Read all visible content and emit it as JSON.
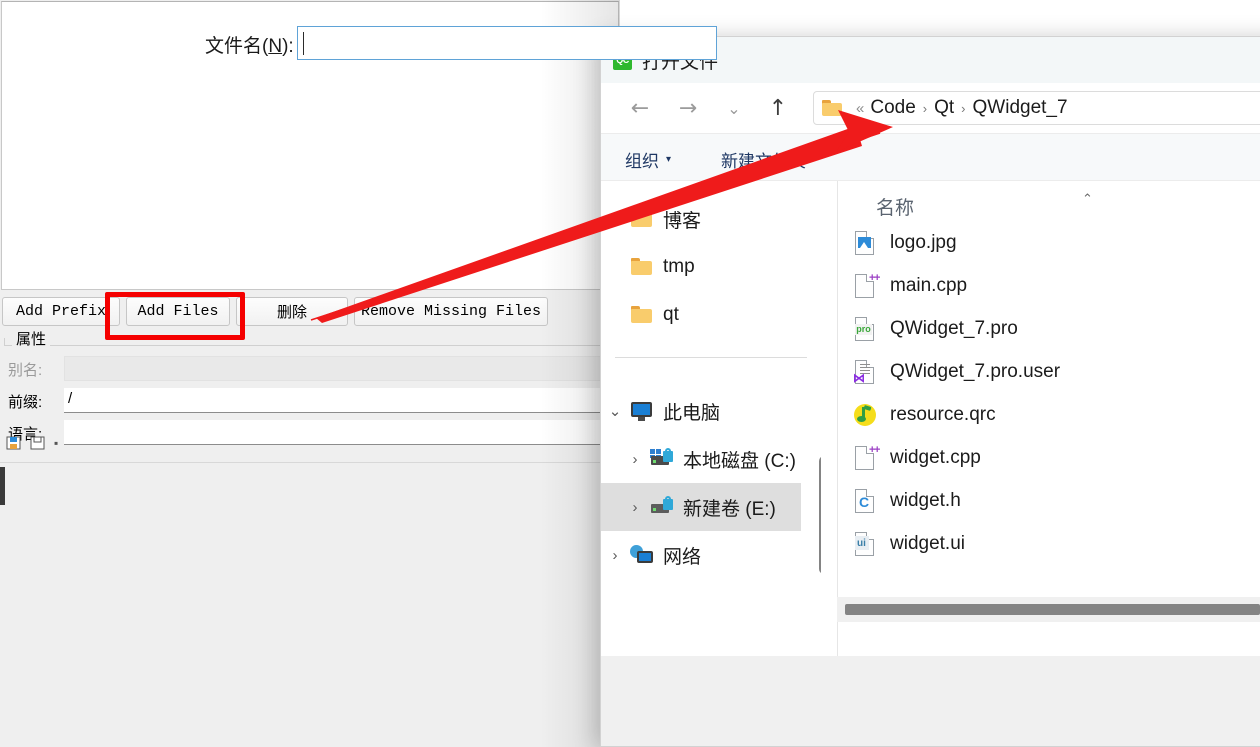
{
  "qt_editor": {
    "buttons": [
      {
        "id": "add-prefix",
        "label": "Add Prefix"
      },
      {
        "id": "add-files",
        "label": "Add Files"
      },
      {
        "id": "delete",
        "label": "删除"
      },
      {
        "id": "remove-missing",
        "label": "Remove Missing Files"
      }
    ],
    "properties": {
      "group_label": "属性",
      "rows": [
        {
          "label": "别名:",
          "value": "",
          "disabled": true
        },
        {
          "label": "前缀:",
          "value": "/",
          "disabled": false
        },
        {
          "label": "语言:",
          "value": "",
          "disabled": false
        }
      ]
    }
  },
  "dialog": {
    "title": "打开文件",
    "app_icon_text": "QC",
    "nav": {
      "back": "←",
      "forward": "→",
      "recent": "⌄",
      "up": "↑"
    },
    "breadcrumb": {
      "overflow": "«",
      "segments": [
        "Code",
        "Qt",
        "QWidget_7"
      ],
      "separator": "›"
    },
    "commands": {
      "organize": "组织",
      "organize_caret": "▾",
      "new_folder": "新建文件夹"
    },
    "sidebar": {
      "items": [
        {
          "label": "博客",
          "icon": "folder-icon",
          "expander": "",
          "indent": 1,
          "selected": false
        },
        {
          "label": "tmp",
          "icon": "folder-icon",
          "expander": "",
          "indent": 1,
          "selected": false
        },
        {
          "label": "qt",
          "icon": "folder-icon",
          "expander": "",
          "indent": 1,
          "selected": false
        },
        {
          "label": "此电脑",
          "icon": "computer-icon",
          "expander": "⌄",
          "indent": 0,
          "selected": false
        },
        {
          "label": "本地磁盘 (C:)",
          "icon": "windows-drive-icon",
          "expander": "›",
          "indent": 1,
          "selected": false
        },
        {
          "label": "新建卷 (E:)",
          "icon": "drive-icon",
          "expander": "›",
          "indent": 1,
          "selected": true
        },
        {
          "label": "网络",
          "icon": "network-icon",
          "expander": "›",
          "indent": 0,
          "selected": false
        }
      ]
    },
    "filelist": {
      "column_header": "名称",
      "sort_caret": "⌃",
      "files": [
        {
          "name": "logo.jpg",
          "icon": "image-file-icon"
        },
        {
          "name": "main.cpp",
          "icon": "cpp-file-icon"
        },
        {
          "name": "QWidget_7.pro",
          "icon": "pro-file-icon"
        },
        {
          "name": "QWidget_7.pro.user",
          "icon": "vs-user-file-icon"
        },
        {
          "name": "resource.qrc",
          "icon": "qrc-file-icon"
        },
        {
          "name": "widget.cpp",
          "icon": "cpp-file-icon"
        },
        {
          "name": "widget.h",
          "icon": "header-file-icon"
        },
        {
          "name": "widget.ui",
          "icon": "ui-file-icon"
        }
      ]
    },
    "footer": {
      "filename_label_pre": "文件名(",
      "filename_label_key": "N",
      "filename_label_post": "):",
      "filename_value": "",
      "filename_placeholder": ""
    }
  },
  "annotations": {
    "highlight_color": "#f50000",
    "arrow_color": "#ef1b1b",
    "highlight_target": "Add Files",
    "arrow_from": "删除",
    "arrow_to": "breadcrumb"
  }
}
